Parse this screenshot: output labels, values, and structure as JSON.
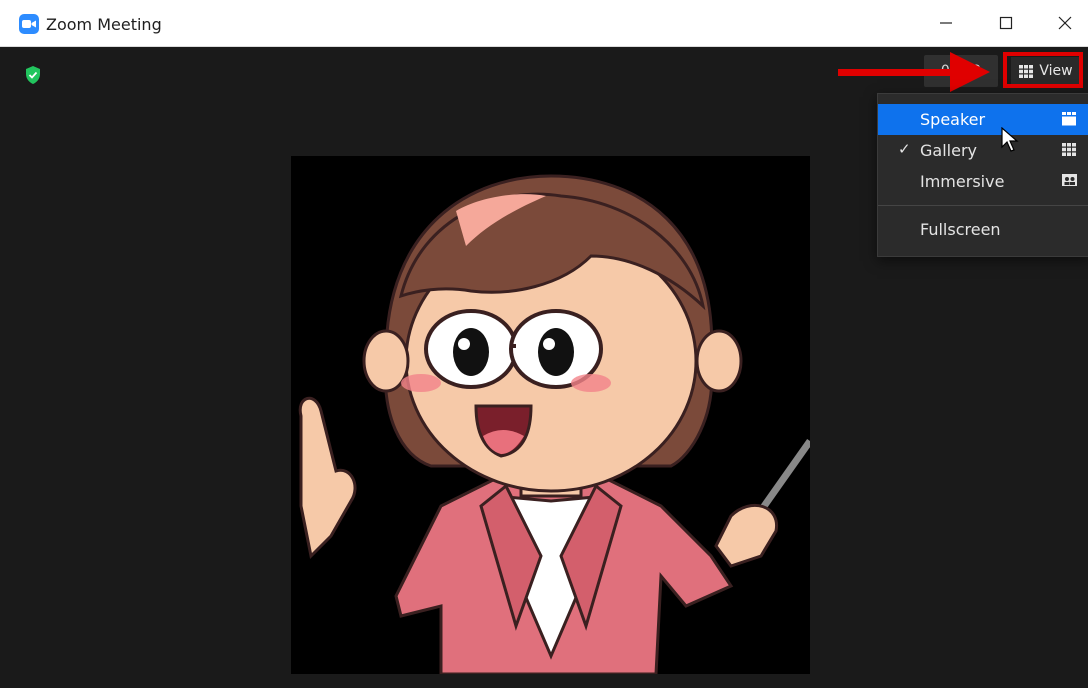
{
  "window": {
    "title": "Zoom Meeting"
  },
  "toolbar": {
    "timer": "00:22",
    "view_label": "View"
  },
  "view_menu": {
    "items": [
      {
        "label": "Speaker",
        "checked": false,
        "highlighted": true,
        "icon": "speaker-view-icon"
      },
      {
        "label": "Gallery",
        "checked": true,
        "highlighted": false,
        "icon": "gallery-view-icon"
      },
      {
        "label": "Immersive",
        "checked": false,
        "highlighted": false,
        "icon": "immersive-view-icon"
      }
    ],
    "fullscreen_label": "Fullscreen",
    "check_glyph": "✓"
  },
  "colors": {
    "accent": "#0e72ed",
    "highlight_box": "#e00000",
    "arrow": "#e00000",
    "stage_bg": "#1a1a1a",
    "shield": "#22c55e"
  }
}
